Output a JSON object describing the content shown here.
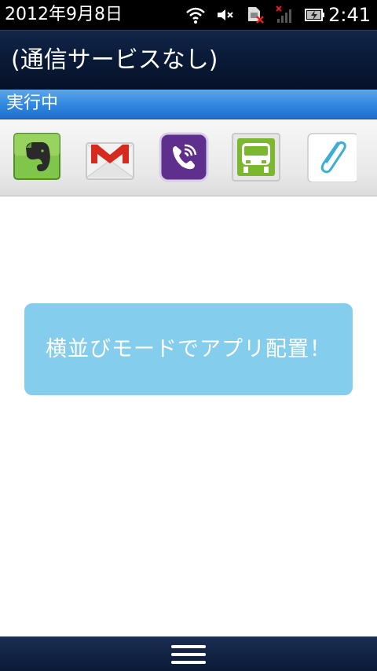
{
  "status_bar": {
    "date": "2012年9月8日",
    "time": "2:41",
    "icons": [
      "wifi-icon",
      "mute-icon",
      "sim-error-icon",
      "no-signal-icon",
      "battery-charging-icon"
    ]
  },
  "title_bar": {
    "title": "(通信サービスなし)"
  },
  "running_section": {
    "label": "実行中",
    "apps": [
      {
        "icon": "evernote-icon",
        "color": "#6fbe3a"
      },
      {
        "icon": "gmail-icon",
        "color": "#d62a1f"
      },
      {
        "icon": "viber-icon",
        "color": "#5e2f8d"
      },
      {
        "icon": "train-icon",
        "color": "#7bb82f"
      },
      {
        "icon": "paperclip-icon",
        "color": "#3aaed6"
      }
    ]
  },
  "banner": {
    "text": "横並びモードでアプリ配置！",
    "color": "#85cdec"
  },
  "bottom_bar": {
    "icon": "menu-icon"
  }
}
